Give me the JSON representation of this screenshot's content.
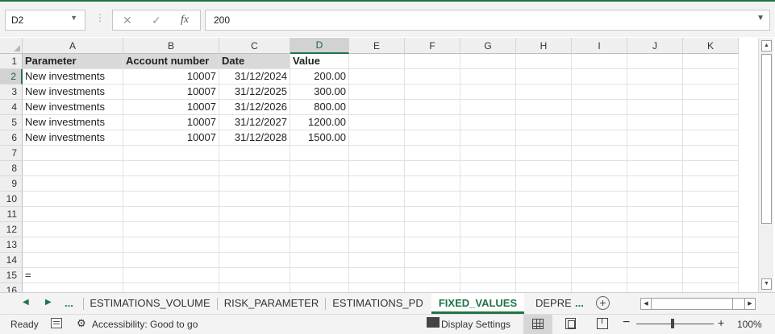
{
  "formula_bar": {
    "name_box": "D2",
    "formula": "200",
    "fx_label": "fx",
    "cancel_glyph": "✕",
    "enter_glyph": "✓"
  },
  "columns": [
    "A",
    "B",
    "C",
    "D",
    "E",
    "F",
    "G",
    "H",
    "I",
    "J",
    "K"
  ],
  "selected_column": "D",
  "selected_row": 2,
  "row_numbers": [
    "1",
    "2",
    "3",
    "4",
    "5",
    "6",
    "7",
    "8",
    "9",
    "10",
    "11",
    "12",
    "13",
    "14",
    "15",
    "16"
  ],
  "cells": {
    "header": [
      "Parameter",
      "Account number",
      "Date",
      "Value"
    ],
    "rows": [
      [
        "New investments",
        "10007",
        "31/12/2024",
        "200.00"
      ],
      [
        "New investments",
        "10007",
        "31/12/2025",
        "300.00"
      ],
      [
        "New investments",
        "10007",
        "31/12/2026",
        "800.00"
      ],
      [
        "New investments",
        "10007",
        "31/12/2027",
        "1200.00"
      ],
      [
        "New investments",
        "10007",
        "31/12/2028",
        "1500.00"
      ]
    ],
    "a15": "="
  },
  "sheet_tabs": {
    "more_left": "...",
    "tabs": [
      "ESTIMATIONS_VOLUME",
      "RISK_PARAMETER",
      "ESTIMATIONS_PD",
      "FIXED_VALUES",
      "DEPREC"
    ],
    "active": "FIXED_VALUES",
    "more_right": "...",
    "add_sheet": "+"
  },
  "status_bar": {
    "ready": "Ready",
    "accessibility": "Accessibility: Good to go",
    "display_settings": "Display Settings",
    "zoom_minus": "−",
    "zoom_plus": "+",
    "zoom_level": "100%",
    "zoom_fraction": 0.47
  },
  "colors": {
    "accent": "#217346",
    "header_fill": "#d9d9d9"
  }
}
